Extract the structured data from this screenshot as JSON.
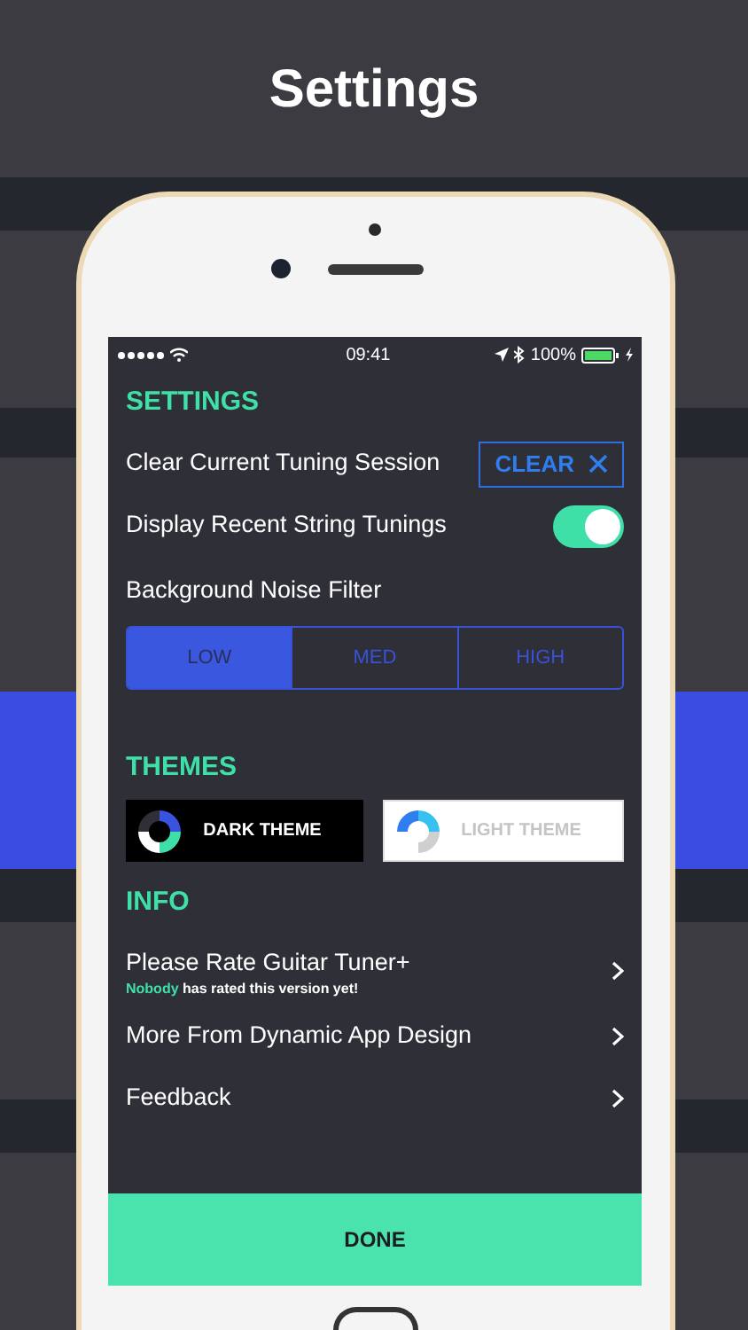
{
  "header": {
    "title": "Settings"
  },
  "status_bar": {
    "time": "09:41",
    "battery": "100%"
  },
  "settings": {
    "heading": "SETTINGS",
    "clear_session": {
      "label": "Clear Current Tuning Session",
      "button": "CLEAR"
    },
    "recent_tunings": {
      "label": "Display Recent String Tunings",
      "on": true
    },
    "noise_filter": {
      "label": "Background Noise Filter",
      "options": [
        {
          "label": "LOW",
          "selected": true
        },
        {
          "label": "MED",
          "selected": false
        },
        {
          "label": "HIGH",
          "selected": false
        }
      ]
    }
  },
  "themes": {
    "heading": "THEMES",
    "options": [
      {
        "label": "DARK THEME",
        "kind": "dark"
      },
      {
        "label": "LIGHT THEME",
        "kind": "light"
      }
    ]
  },
  "info": {
    "heading": "INFO",
    "items": [
      {
        "title": "Please Rate Guitar Tuner+",
        "subtitle": "**Nobody** has rated this version yet!"
      },
      {
        "title": "More From Dynamic App Design"
      },
      {
        "title": "Feedback"
      }
    ]
  },
  "done_button": "DONE"
}
